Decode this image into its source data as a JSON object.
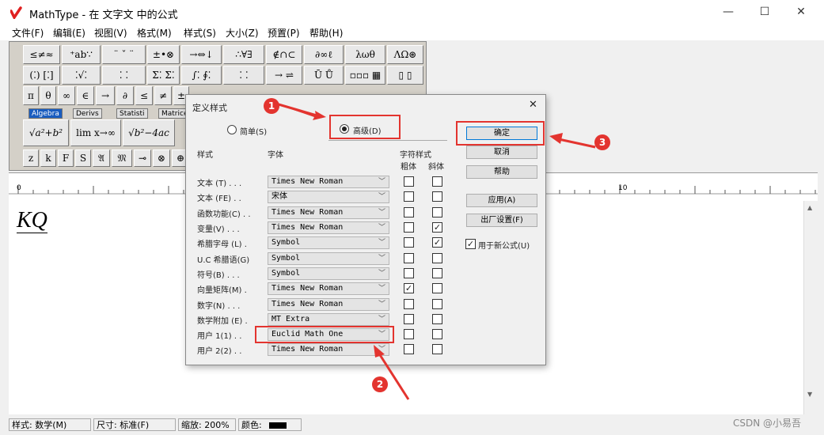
{
  "window": {
    "title": "MathType - 在 文字文 中的公式",
    "min": "—",
    "max": "☐",
    "close": "✕"
  },
  "menu": [
    "文件(F)",
    "编辑(E)",
    "视图(V)",
    "格式(M)",
    "样式(S)",
    "大小(Z)",
    "预置(P)",
    "帮助(H)"
  ],
  "palette": {
    "row1": [
      "≤≠≈",
      "⁺ab∵",
      "¨ ˇ ¨",
      "±•⊗",
      "→⇔↓",
      "∴∀∃",
      "∉∩⊂",
      "∂∞ℓ",
      "λωθ",
      "ΛΩ⊛"
    ],
    "row2": [
      "(⁚) [⁚]",
      "⁚√⁚",
      "⁚ ⁚",
      "Σ⁚ Σ⁚",
      "∫⁚ ∮⁚",
      "⁚ ⁚",
      "→ ⇌",
      "Ū Ů",
      "▫▫▫ ▦",
      "▯ ▯"
    ],
    "row3": [
      "π",
      "θ",
      "∞",
      "∈",
      "→",
      "∂",
      "≤",
      "≠",
      "±"
    ],
    "tabs": [
      "Algebra",
      "Derivs",
      "Statisti",
      "Matrice"
    ],
    "templates": [
      "√a²+b²",
      "lim x→∞",
      "√b²−4ac"
    ],
    "row5": [
      "z",
      "k",
      "F",
      "S",
      "𝔄",
      "𝔐",
      "⊸",
      "⊗",
      "⊕"
    ],
    "small": [
      "t",
      "↑",
      "↑",
      "↑",
      "↑"
    ]
  },
  "ruler": {
    "start": "0",
    "mark": "10"
  },
  "document": {
    "expression": "KQ"
  },
  "status": {
    "style": "样式: 数学(M)",
    "size": "尺寸: 标准(F)",
    "zoom": "缩放: 200%",
    "color": "颜色:"
  },
  "watermark": "CSDN @小易吾",
  "dialog": {
    "title": "定义样式",
    "close": "✕",
    "simple": "简单(S)",
    "advanced": "高级(D)",
    "col_style": "样式",
    "col_font": "字体",
    "col_charstyle": "字符样式",
    "col_bold": "粗体",
    "col_italic": "斜体",
    "rows": [
      {
        "label": "文本 (T) . . .",
        "font": "Times New Roman",
        "bold": false,
        "italic": false
      },
      {
        "label": "文本 (FE) . .",
        "font": "宋体",
        "bold": false,
        "italic": false
      },
      {
        "label": "函数功能(C) . .",
        "font": "Times New Roman",
        "bold": false,
        "italic": false
      },
      {
        "label": "变量(V) . . .",
        "font": "Times New Roman",
        "bold": false,
        "italic": true
      },
      {
        "label": "希腊字母 (L) .",
        "font": "Symbol",
        "bold": false,
        "italic": true
      },
      {
        "label": "U.C 希腊语(G)",
        "font": "Symbol",
        "bold": false,
        "italic": false
      },
      {
        "label": "符号(B) . . .",
        "font": "Symbol",
        "bold": false,
        "italic": false
      },
      {
        "label": "向量矩阵(M) .",
        "font": "Times New Roman",
        "bold": true,
        "italic": false
      },
      {
        "label": "数字(N) . . .",
        "font": "Times New Roman",
        "bold": false,
        "italic": false
      },
      {
        "label": "数学附加 (E) .",
        "font": "MT Extra",
        "bold": false,
        "italic": false
      },
      {
        "label": "用户 1(1) . .",
        "font": "Euclid Math One",
        "bold": false,
        "italic": false
      },
      {
        "label": "用户 2(2) . .",
        "font": "Times New Roman",
        "bold": false,
        "italic": false
      }
    ],
    "buttons": {
      "ok": "确定",
      "cancel": "取消",
      "help": "帮助",
      "apply": "应用(A)",
      "factory": "出厂设置(F)"
    },
    "use_for_new": "用于新公式(U)",
    "use_for_new_checked": true
  },
  "annotations": [
    "1",
    "2",
    "3"
  ],
  "colors": {
    "accent_red": "#e3342f",
    "logo_red": "#e02020",
    "tab_blue": "#1a5dbf"
  }
}
